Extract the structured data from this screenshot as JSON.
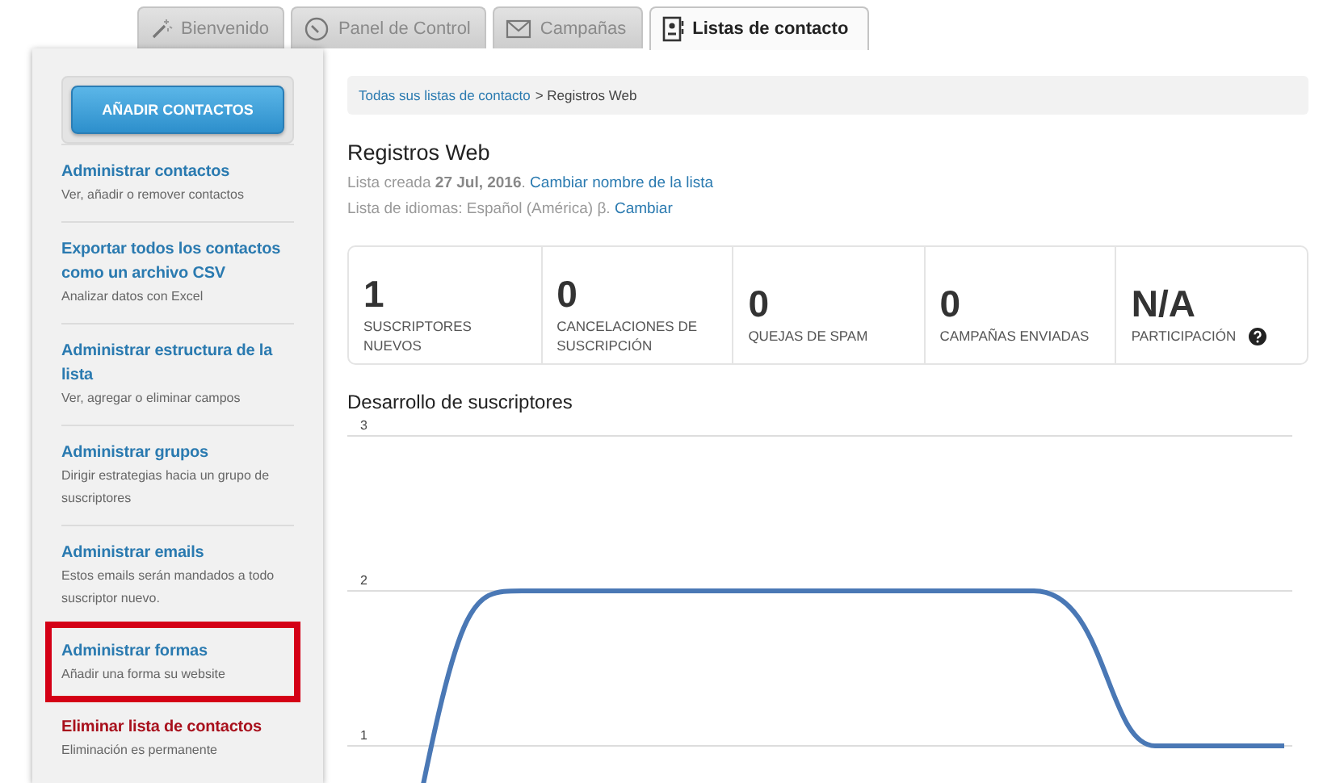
{
  "tabs": [
    {
      "label": "Bienvenido",
      "selected": false
    },
    {
      "label": "Panel de Control",
      "selected": false
    },
    {
      "label": "Campañas",
      "selected": false
    },
    {
      "label": "Listas de contacto",
      "selected": true
    }
  ],
  "sidebar": {
    "button": "AÑADIR CONTACTOS",
    "items": [
      {
        "kind": "link",
        "title": "Administrar contactos",
        "description": "Ver, añadir o remover contactos",
        "highlighted": false
      },
      {
        "kind": "link",
        "title": "Exportar todos los contactos como un archivo CSV",
        "description": "Analizar datos con Excel",
        "highlighted": false
      },
      {
        "kind": "link",
        "title": "Administrar estructura de la lista",
        "description": "Ver, agregar o eliminar campos",
        "highlighted": false
      },
      {
        "kind": "link",
        "title": "Administrar grupos",
        "description": "Dirigir estrategias hacia un grupo de suscriptores",
        "highlighted": false
      },
      {
        "kind": "link",
        "title": "Administrar emails",
        "description": "Estos emails serán mandados a todo suscriptor nuevo.",
        "highlighted": false
      },
      {
        "kind": "link",
        "title": "Administrar formas",
        "description": "Añadir una forma su website",
        "highlighted": true
      },
      {
        "kind": "danger",
        "title": "Eliminar lista de contactos",
        "description": "Eliminación es permanente",
        "highlighted": false
      }
    ]
  },
  "breadcrumb": {
    "link": "Todas sus listas de contacto",
    "current": "> Registros Web"
  },
  "list": {
    "title": "Registros Web",
    "lines": [
      {
        "text": "Lista creada **27 Jul, 2016**.",
        "link": "Cambiar nombre de la lista"
      },
      {
        "text": "Lista de idiomas: Español (América) β.",
        "link": "Cambiar"
      }
    ]
  },
  "stats": [
    {
      "value": "1",
      "label": "SUSCRIPTORES NUEVOS",
      "help": false
    },
    {
      "value": "0",
      "label": "CANCELACIONES DE SUSCRIPCIÓN",
      "help": false
    },
    {
      "value": "0",
      "label": "QUEJAS DE SPAM",
      "help": false
    },
    {
      "value": "0",
      "label": "CAMPAÑAS ENVIADAS",
      "help": false
    },
    {
      "value": "N/A",
      "label": "PARTICIPACIÓN",
      "help": true
    }
  ],
  "chart": {
    "title": "Desarrollo de suscriptores",
    "y_labels": [
      "3",
      "2",
      "1"
    ]
  }
}
